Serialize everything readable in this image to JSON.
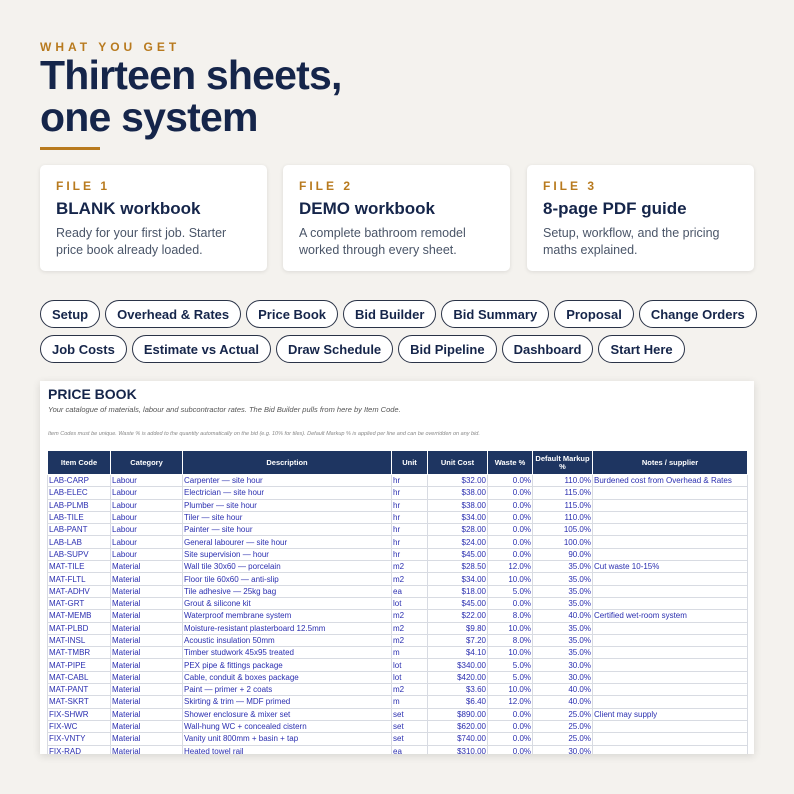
{
  "eyebrow": "WHAT YOU GET",
  "headline": {
    "line1": "Thirteen sheets,",
    "line2": "one system"
  },
  "accent_color": "#b87a1e",
  "navy_color": "#15254a",
  "cards": [
    {
      "label": "FILE 1",
      "title": "BLANK workbook",
      "desc": "Ready for your first job. Starter price book already loaded."
    },
    {
      "label": "FILE 2",
      "title": "DEMO workbook",
      "desc": "A complete bathroom remodel worked through every sheet."
    },
    {
      "label": "FILE 3",
      "title": "8-page PDF guide",
      "desc": "Setup, workflow, and the pricing maths explained."
    }
  ],
  "chips_row1": [
    "Setup",
    "Overhead & Rates",
    "Price Book",
    "Bid Builder",
    "Bid Summary",
    "Proposal",
    "Change Orders"
  ],
  "chips_row2": [
    "Job Costs",
    "Estimate vs Actual",
    "Draw Schedule",
    "Bid Pipeline",
    "Dashboard",
    "Start Here"
  ],
  "sheet": {
    "title": "PRICE BOOK",
    "subtitle": "Your catalogue of materials, labour and subcontractor rates. The Bid Builder pulls from here by Item Code.",
    "note": "Item Codes must be unique. Waste % is added to the quantity automatically on the bid (e.g. 10% for tiles). Default Markup % is applied per line and can be overridden on any bid.",
    "columns": [
      "Item Code",
      "Category",
      "Description",
      "Unit",
      "Unit Cost",
      "Waste %",
      "Default Markup %",
      "Notes / supplier"
    ],
    "rows": [
      [
        "LAB-CARP",
        "Labour",
        "Carpenter — site hour",
        "hr",
        "$32.00",
        "0.0%",
        "110.0%",
        "Burdened cost from Overhead & Rates"
      ],
      [
        "LAB-ELEC",
        "Labour",
        "Electrician — site hour",
        "hr",
        "$38.00",
        "0.0%",
        "115.0%",
        ""
      ],
      [
        "LAB-PLMB",
        "Labour",
        "Plumber — site hour",
        "hr",
        "$38.00",
        "0.0%",
        "115.0%",
        ""
      ],
      [
        "LAB-TILE",
        "Labour",
        "Tiler — site hour",
        "hr",
        "$34.00",
        "0.0%",
        "110.0%",
        ""
      ],
      [
        "LAB-PANT",
        "Labour",
        "Painter — site hour",
        "hr",
        "$28.00",
        "0.0%",
        "105.0%",
        ""
      ],
      [
        "LAB-LAB",
        "Labour",
        "General labourer — site hour",
        "hr",
        "$24.00",
        "0.0%",
        "100.0%",
        ""
      ],
      [
        "LAB-SUPV",
        "Labour",
        "Site supervision — hour",
        "hr",
        "$45.00",
        "0.0%",
        "90.0%",
        ""
      ],
      [
        "MAT-TILE",
        "Material",
        "Wall tile 30x60 — porcelain",
        "m2",
        "$28.50",
        "12.0%",
        "35.0%",
        "Cut waste 10-15%"
      ],
      [
        "MAT-FLTL",
        "Material",
        "Floor tile 60x60 — anti-slip",
        "m2",
        "$34.00",
        "10.0%",
        "35.0%",
        ""
      ],
      [
        "MAT-ADHV",
        "Material",
        "Tile adhesive — 25kg bag",
        "ea",
        "$18.00",
        "5.0%",
        "35.0%",
        ""
      ],
      [
        "MAT-GRT",
        "Material",
        "Grout & silicone kit",
        "lot",
        "$45.00",
        "0.0%",
        "35.0%",
        ""
      ],
      [
        "MAT-MEMB",
        "Material",
        "Waterproof membrane system",
        "m2",
        "$22.00",
        "8.0%",
        "40.0%",
        "Certified wet-room system"
      ],
      [
        "MAT-PLBD",
        "Material",
        "Moisture-resistant plasterboard 12.5mm",
        "m2",
        "$9.80",
        "10.0%",
        "35.0%",
        ""
      ],
      [
        "MAT-INSL",
        "Material",
        "Acoustic insulation 50mm",
        "m2",
        "$7.20",
        "8.0%",
        "35.0%",
        ""
      ],
      [
        "MAT-TMBR",
        "Material",
        "Timber studwork 45x95 treated",
        "m",
        "$4.10",
        "10.0%",
        "35.0%",
        ""
      ],
      [
        "MAT-PIPE",
        "Material",
        "PEX pipe & fittings package",
        "lot",
        "$340.00",
        "5.0%",
        "30.0%",
        ""
      ],
      [
        "MAT-CABL",
        "Material",
        "Cable, conduit & boxes package",
        "lot",
        "$420.00",
        "5.0%",
        "30.0%",
        ""
      ],
      [
        "MAT-PANT",
        "Material",
        "Paint — primer + 2 coats",
        "m2",
        "$3.60",
        "10.0%",
        "40.0%",
        ""
      ],
      [
        "MAT-SKRT",
        "Material",
        "Skirting & trim — MDF primed",
        "m",
        "$6.40",
        "12.0%",
        "40.0%",
        ""
      ],
      [
        "FIX-SHWR",
        "Material",
        "Shower enclosure & mixer set",
        "set",
        "$890.00",
        "0.0%",
        "25.0%",
        "Client may supply"
      ],
      [
        "FIX-WC",
        "Material",
        "Wall-hung WC + concealed cistern",
        "set",
        "$620.00",
        "0.0%",
        "25.0%",
        ""
      ],
      [
        "FIX-VNTY",
        "Material",
        "Vanity unit 800mm + basin + tap",
        "set",
        "$740.00",
        "0.0%",
        "25.0%",
        ""
      ],
      [
        "FIX-RAD",
        "Material",
        "Heated towel rail",
        "ea",
        "$310.00",
        "0.0%",
        "30.0%",
        ""
      ]
    ]
  }
}
